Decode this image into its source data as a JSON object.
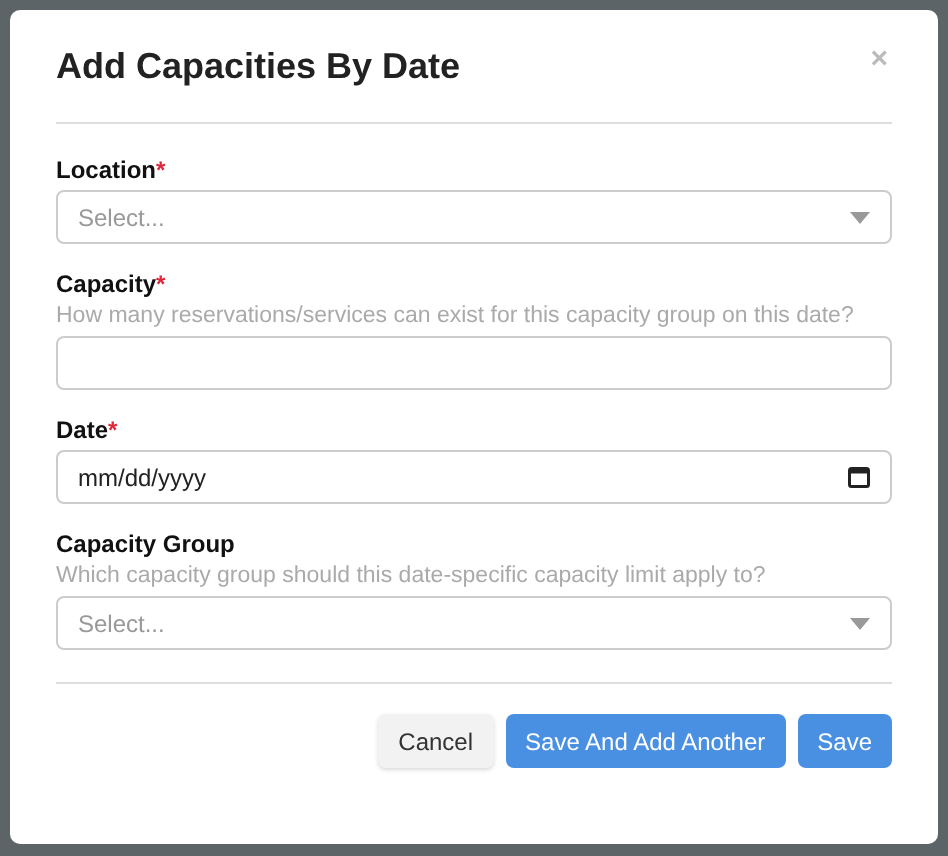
{
  "dialog": {
    "title": "Add Capacities By Date",
    "close": "×"
  },
  "fields": [
    {
      "kind": "select",
      "label": "Location",
      "required_mark": "*",
      "placeholder": "Select..."
    },
    {
      "kind": "number",
      "label": "Capacity",
      "required_mark": "*",
      "help": "How many reservations/services can exist for this capacity group on this date?"
    },
    {
      "kind": "date",
      "label": "Date",
      "required_mark": "*",
      "placeholder": "mm/dd/yyyy"
    },
    {
      "kind": "select",
      "label": "Capacity Group",
      "help": "Which capacity group should this date-specific capacity limit apply to?",
      "placeholder": "Select..."
    }
  ],
  "buttons": [
    {
      "label": "Cancel",
      "kind": "default"
    },
    {
      "label": "Save And Add Another",
      "kind": "primary"
    },
    {
      "label": "Save",
      "kind": "primary"
    }
  ]
}
